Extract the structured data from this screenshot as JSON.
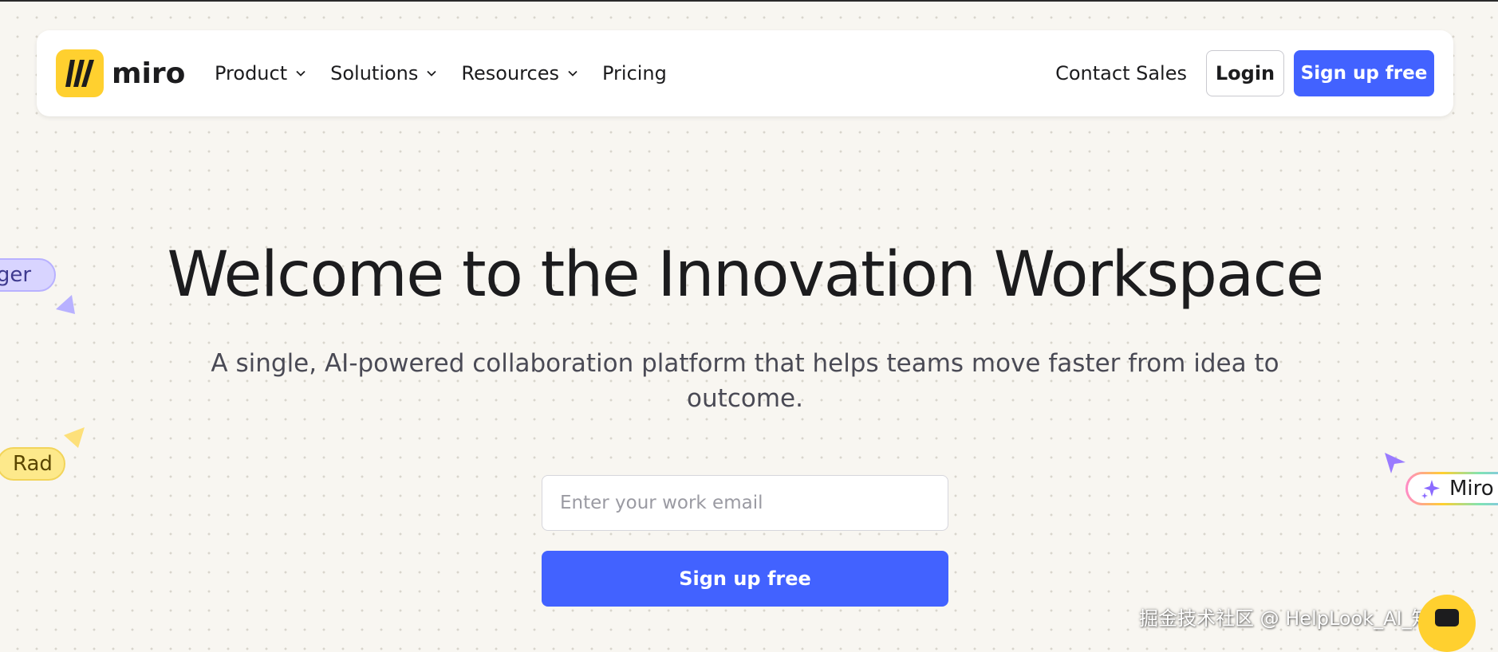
{
  "brand": {
    "name": "miro",
    "logo_color": "#ffd02f"
  },
  "nav": {
    "items": [
      {
        "label": "Product",
        "has_dropdown": true
      },
      {
        "label": "Solutions",
        "has_dropdown": true
      },
      {
        "label": "Resources",
        "has_dropdown": true
      },
      {
        "label": "Pricing",
        "has_dropdown": false
      }
    ],
    "contact_sales": "Contact Sales",
    "login": "Login",
    "signup": "Sign up free"
  },
  "hero": {
    "title": "Welcome to the Innovation Workspace",
    "subtitle": "A single, AI-powered collaboration platform that helps teams move faster from idea to outcome.",
    "email_placeholder": "Enter your work email",
    "signup": "Sign up free"
  },
  "cursors": {
    "roger": "oger",
    "rad": "Rad",
    "miro_ai": "Miro"
  },
  "watermark": "掘金技术社区 @ HelpLook_AI_知识库",
  "colors": {
    "accent": "#4262ff",
    "background": "#f8f6f1",
    "logo_yellow": "#ffd02f",
    "roger_tag": "#d8d4ff",
    "rad_tag": "#fde98b"
  },
  "icons": [
    "miro-logo-icon",
    "chevron-down-icon",
    "cursor-arrow-icon",
    "sparkle-icon",
    "chat-icon"
  ]
}
